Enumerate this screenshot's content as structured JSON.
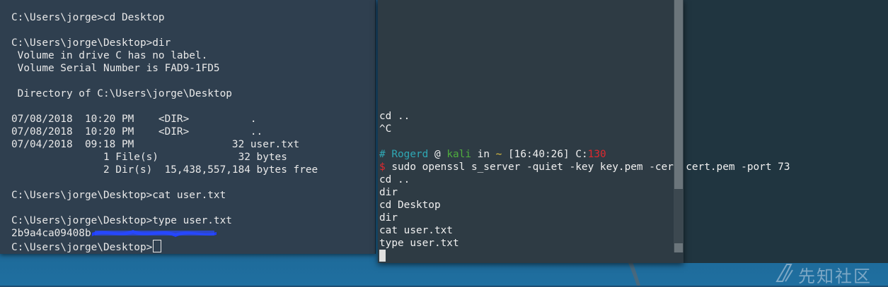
{
  "left_terminal": {
    "lines": [
      "C:\\Users\\jorge>cd Desktop",
      "",
      "C:\\Users\\jorge\\Desktop>dir",
      " Volume in drive C has no label.",
      " Volume Serial Number is FAD9-1FD5",
      "",
      " Directory of C:\\Users\\jorge\\Desktop",
      "",
      "07/08/2018  10:20 PM    <DIR>          .",
      "07/08/2018  10:20 PM    <DIR>          ..",
      "07/04/2018  09:18 PM                32 user.txt",
      "               1 File(s)             32 bytes",
      "               2 Dir(s)  15,438,557,184 bytes free",
      "",
      "C:\\Users\\jorge\\Desktop>cat user.txt",
      "",
      "C:\\Users\\jorge\\Desktop>type user.txt",
      "2b9a4ca09408b"
    ],
    "prompt": "C:\\Users\\jorge\\Desktop>"
  },
  "right_terminal": {
    "lines_top": [
      "cd ..",
      "^C",
      ""
    ],
    "prompt": {
      "hash": "#",
      "user": "Rogerd",
      "at": "@",
      "host": "kali",
      "in": "in",
      "dir": "~",
      "time": "[16:40:26]",
      "code_label": "C:",
      "code": "130"
    },
    "command_symbol": "$",
    "command": "sudo openssl s_server -quiet -key key.pem -cert cert.pem -port 73",
    "lines_bottom": [
      "cd ..",
      "dir",
      "cd Desktop",
      "dir",
      "cat user.txt",
      "type user.txt"
    ]
  },
  "watermark": {
    "text": "先知社区"
  },
  "colors": {
    "left_bg": "#2f3f4f",
    "right_bg": "#2e3b44",
    "desktop": "#1c5c86"
  }
}
